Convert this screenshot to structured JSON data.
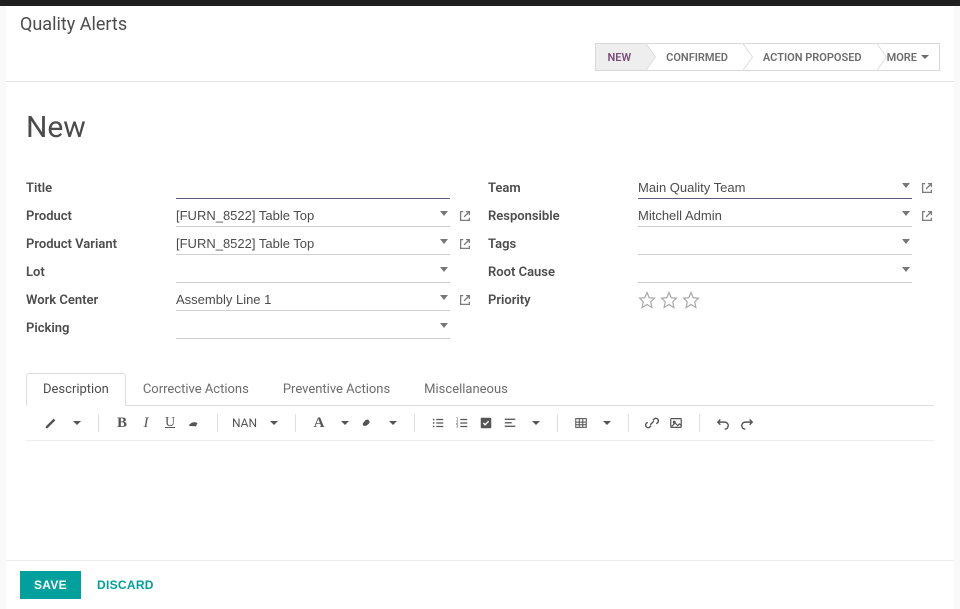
{
  "breadcrumb": {
    "title": "Quality Alerts"
  },
  "statusbar": {
    "steps": [
      {
        "label": "NEW",
        "active": true
      },
      {
        "label": "CONFIRMED",
        "active": false
      },
      {
        "label": "ACTION PROPOSED",
        "active": false
      }
    ],
    "more_label": "MORE"
  },
  "record": {
    "title": "New"
  },
  "labels": {
    "title": "Title",
    "product": "Product",
    "product_variant": "Product Variant",
    "lot": "Lot",
    "work_center": "Work Center",
    "picking": "Picking",
    "team": "Team",
    "responsible": "Responsible",
    "tags": "Tags",
    "root_cause": "Root Cause",
    "priority": "Priority"
  },
  "fields": {
    "title": "",
    "product": "[FURN_8522] Table Top",
    "product_variant": "[FURN_8522] Table Top",
    "lot": "",
    "work_center": "Assembly Line 1",
    "picking": "",
    "team": "Main Quality Team",
    "responsible": "Mitchell Admin",
    "tags": "",
    "root_cause": ""
  },
  "tabs": {
    "items": [
      {
        "label": "Description",
        "active": true
      },
      {
        "label": "Corrective Actions",
        "active": false
      },
      {
        "label": "Preventive Actions",
        "active": false
      },
      {
        "label": "Miscellaneous",
        "active": false
      }
    ]
  },
  "editor": {
    "font_size_label": "NAN",
    "font_glyph": "A"
  },
  "footer": {
    "save": "SAVE",
    "discard": "DISCARD"
  }
}
